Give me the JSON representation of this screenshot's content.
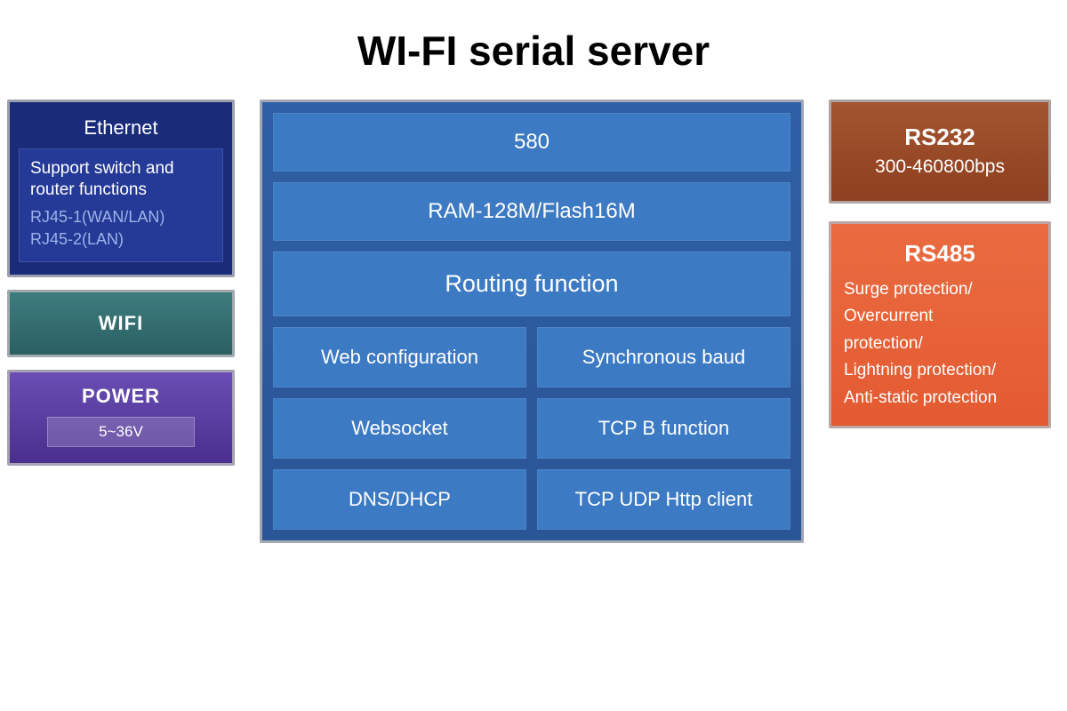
{
  "title": "WI-FI serial server",
  "left": {
    "ethernet": {
      "title": "Ethernet",
      "desc": "Support switch and router functions",
      "port1": "RJ45-1(WAN/LAN)",
      "port2": "RJ45-2(LAN)"
    },
    "wifi": {
      "label": "WIFI"
    },
    "power": {
      "label": "POWER",
      "spec": "5~36V"
    }
  },
  "center": {
    "row1": "580",
    "row2": "RAM-128M/Flash16M",
    "row3": "Routing function",
    "cells": [
      "Web configuration",
      "Synchronous baud",
      "Websocket",
      "TCP B function",
      "DNS/DHCP",
      "TCP UDP Http client"
    ]
  },
  "right": {
    "rs232": {
      "title": "RS232",
      "spec": "300-460800bps"
    },
    "rs485": {
      "title": "RS485",
      "lines": [
        "Surge protection/",
        "Overcurrent",
        "protection/",
        "Lightning protection/",
        "Anti-static protection"
      ]
    }
  }
}
